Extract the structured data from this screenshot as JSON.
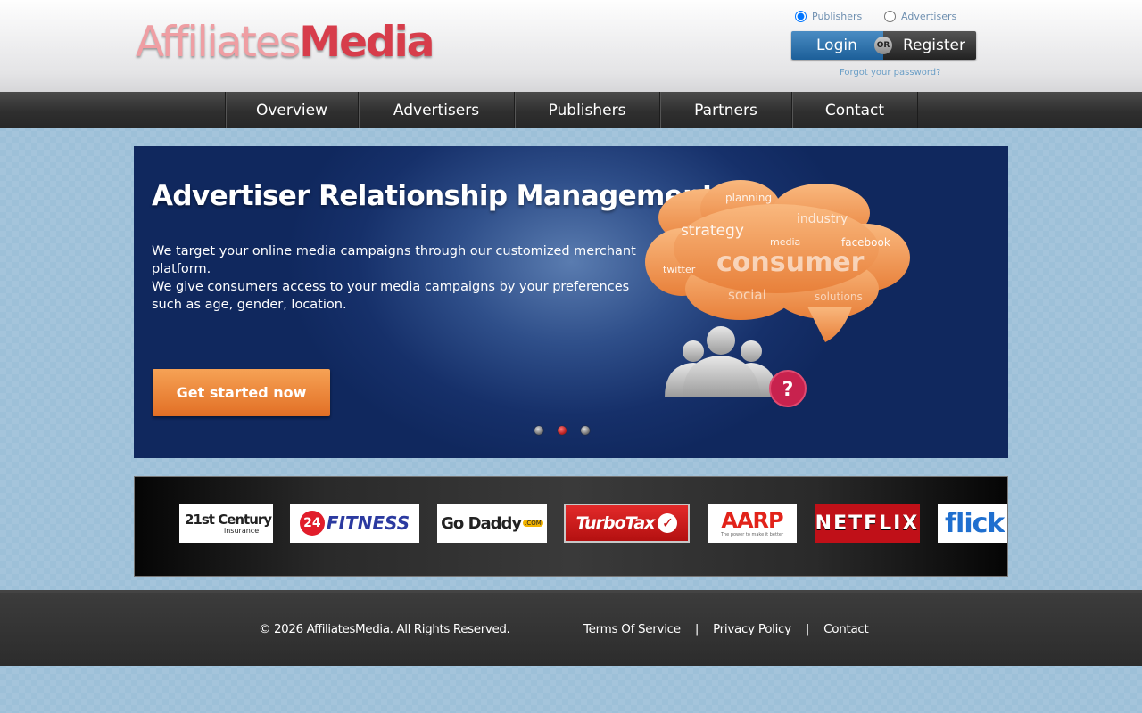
{
  "header": {
    "logo_part1": "Affiliates",
    "logo_part2": "Media",
    "account_types": [
      {
        "label": "Publishers",
        "checked": true
      },
      {
        "label": "Advertisers",
        "checked": false
      }
    ],
    "login_label": "Login",
    "or_label": "OR",
    "register_label": "Register",
    "forgot_label": "Forgot your password?"
  },
  "nav": {
    "items": [
      "Overview",
      "Advertisers",
      "Publishers",
      "Partners",
      "Contact"
    ]
  },
  "hero": {
    "title": "Advertiser Relationship Management",
    "paragraph1": "We target your online media campaigns through our customized merchant platform.",
    "paragraph2": "We give consumers access to your media campaigns by your preferences such as age, gender, location.",
    "cta_label": "Get started now",
    "cloud_words": {
      "planning": "planning",
      "strategy": "strategy",
      "industry": "industry",
      "media": "media",
      "facebook": "facebook",
      "twitter": "twitter",
      "consumer": "consumer",
      "social": "social",
      "solutions": "solutions"
    },
    "question_mark": "?",
    "slides": 3,
    "active_slide": 2,
    "colors": {
      "cta": "#ef8a3a",
      "cloud": "#f0944c",
      "question_badge": "#c8224e"
    }
  },
  "partners": {
    "logos": [
      {
        "name": "21st Century insurance",
        "text_main": "21st Century",
        "text_sub": "insurance"
      },
      {
        "name": "24 Hour Fitness",
        "text_badge": "24",
        "text_main": "FITNESS"
      },
      {
        "name": "Go Daddy",
        "text_main": "Go Daddy",
        "text_sub": ".COM"
      },
      {
        "name": "TurboTax",
        "text_main": "TurboTax"
      },
      {
        "name": "AARP",
        "text_main": "AARP",
        "text_sub": "The power to make it better"
      },
      {
        "name": "Netflix",
        "text_main": "NETFLIX"
      },
      {
        "name": "flickr",
        "text_main": "flick"
      }
    ]
  },
  "footer": {
    "copyright": "© 2026 AffiliatesMedia. All Rights Reserved.",
    "links": [
      "Terms Of Service",
      "Privacy Policy",
      "Contact"
    ],
    "separator": "|"
  }
}
